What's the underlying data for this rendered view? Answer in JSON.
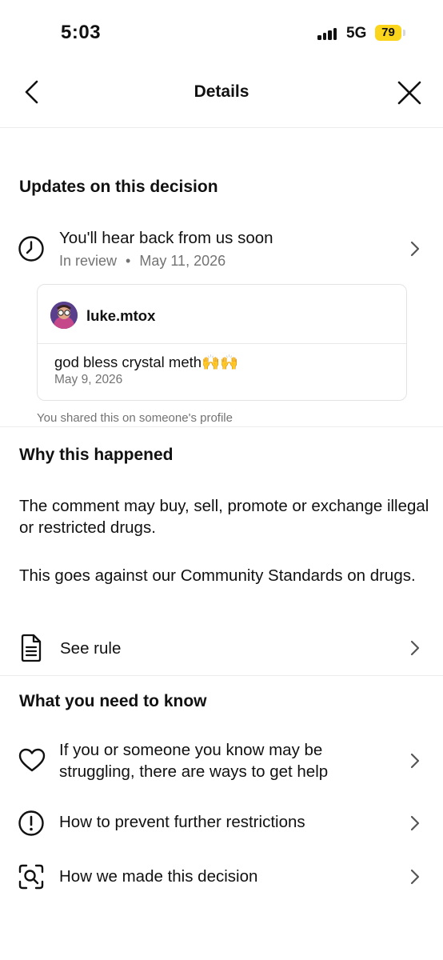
{
  "status_bar": {
    "time": "5:03",
    "network": "5G",
    "battery": "79",
    "battery_color": "#fad51b"
  },
  "nav": {
    "title": "Details",
    "back_icon": "chevron-left-icon",
    "close_icon": "close-icon"
  },
  "updates": {
    "heading": "Updates on this decision",
    "status_row": {
      "icon": "clock-icon",
      "title": "You'll hear back from us soon",
      "status": "In review",
      "separator": "•",
      "date": "May 11, 2026"
    },
    "comment_card": {
      "username": "luke.mtox",
      "text": "god bless crystal meth🙌🙌",
      "date": "May 9, 2026"
    },
    "shared_note": "You shared this on someone's profile"
  },
  "why": {
    "heading": "Why this happened",
    "paragraph_1": "The comment may buy, sell, promote or exchange illegal or restricted drugs.",
    "paragraph_2": "This goes against our Community Standards on drugs.",
    "see_rule": {
      "icon": "document-icon",
      "label": "See rule"
    }
  },
  "know": {
    "heading": "What you need to know",
    "items": [
      {
        "icon": "heart-icon",
        "label": "If you or someone you know may be struggling, there are ways to get help"
      },
      {
        "icon": "exclamation-circle-icon",
        "label": "How to prevent further restrictions"
      },
      {
        "icon": "search-frame-icon",
        "label": "How we made this decision"
      }
    ]
  }
}
